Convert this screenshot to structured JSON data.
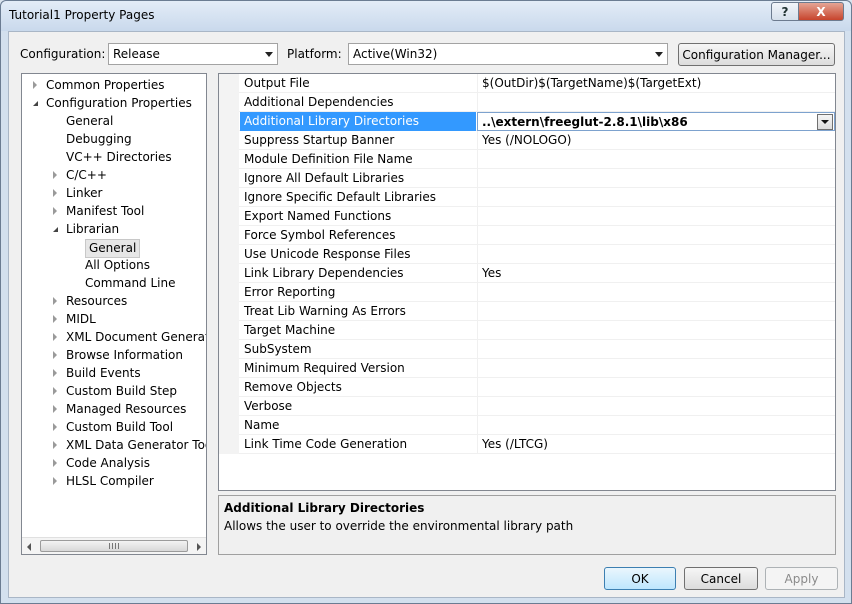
{
  "window": {
    "title": "Tutorial1 Property Pages",
    "help_label": "?",
    "close_label": "X"
  },
  "header": {
    "configuration_label": "Configuration:",
    "configuration_value": "Release",
    "platform_label": "Platform:",
    "platform_value": "Active(Win32)",
    "config_manager_label": "Configuration Manager..."
  },
  "tree": {
    "items": [
      {
        "label": "Common Properties",
        "state": "collapsed"
      },
      {
        "label": "Configuration Properties",
        "state": "expanded"
      },
      {
        "label": "General",
        "state": "leaf"
      },
      {
        "label": "Debugging",
        "state": "leaf"
      },
      {
        "label": "VC++ Directories",
        "state": "leaf"
      },
      {
        "label": "C/C++",
        "state": "collapsed"
      },
      {
        "label": "Linker",
        "state": "collapsed"
      },
      {
        "label": "Manifest Tool",
        "state": "collapsed"
      },
      {
        "label": "Librarian",
        "state": "expanded"
      },
      {
        "label": "General",
        "state": "selected"
      },
      {
        "label": "All Options",
        "state": "leaf"
      },
      {
        "label": "Command Line",
        "state": "leaf"
      },
      {
        "label": "Resources",
        "state": "collapsed"
      },
      {
        "label": "MIDL",
        "state": "collapsed"
      },
      {
        "label": "XML Document Generator",
        "state": "collapsed"
      },
      {
        "label": "Browse Information",
        "state": "collapsed"
      },
      {
        "label": "Build Events",
        "state": "collapsed"
      },
      {
        "label": "Custom Build Step",
        "state": "collapsed"
      },
      {
        "label": "Managed Resources",
        "state": "collapsed"
      },
      {
        "label": "Custom Build Tool",
        "state": "collapsed"
      },
      {
        "label": "XML Data Generator Tool",
        "state": "collapsed"
      },
      {
        "label": "Code Analysis",
        "state": "collapsed"
      },
      {
        "label": "HLSL Compiler",
        "state": "collapsed"
      }
    ]
  },
  "properties": {
    "rows": [
      {
        "name": "Output File",
        "value": "$(OutDir)$(TargetName)$(TargetExt)"
      },
      {
        "name": "Additional Dependencies",
        "value": ""
      },
      {
        "name": "Additional Library Directories",
        "value": "..\\extern\\freeglut-2.8.1\\lib\\x86",
        "selected": true
      },
      {
        "name": "Suppress Startup Banner",
        "value": "Yes (/NOLOGO)"
      },
      {
        "name": "Module Definition File Name",
        "value": ""
      },
      {
        "name": "Ignore All Default Libraries",
        "value": ""
      },
      {
        "name": "Ignore Specific Default Libraries",
        "value": ""
      },
      {
        "name": "Export Named Functions",
        "value": ""
      },
      {
        "name": "Force Symbol References",
        "value": ""
      },
      {
        "name": "Use Unicode Response Files",
        "value": ""
      },
      {
        "name": "Link Library Dependencies",
        "value": "Yes"
      },
      {
        "name": "Error Reporting",
        "value": ""
      },
      {
        "name": "Treat Lib Warning As Errors",
        "value": ""
      },
      {
        "name": "Target Machine",
        "value": ""
      },
      {
        "name": "SubSystem",
        "value": ""
      },
      {
        "name": "Minimum Required Version",
        "value": ""
      },
      {
        "name": "Remove Objects",
        "value": ""
      },
      {
        "name": "Verbose",
        "value": ""
      },
      {
        "name": "Name",
        "value": ""
      },
      {
        "name": "Link Time Code Generation",
        "value": "Yes (/LTCG)"
      }
    ]
  },
  "description": {
    "title": "Additional Library Directories",
    "text": "Allows the user to override the environmental library path"
  },
  "footer": {
    "ok_label": "OK",
    "cancel_label": "Cancel",
    "apply_label": "Apply"
  },
  "colors": {
    "selection": "#3399ff",
    "accent_border": "#3c7fb1"
  }
}
